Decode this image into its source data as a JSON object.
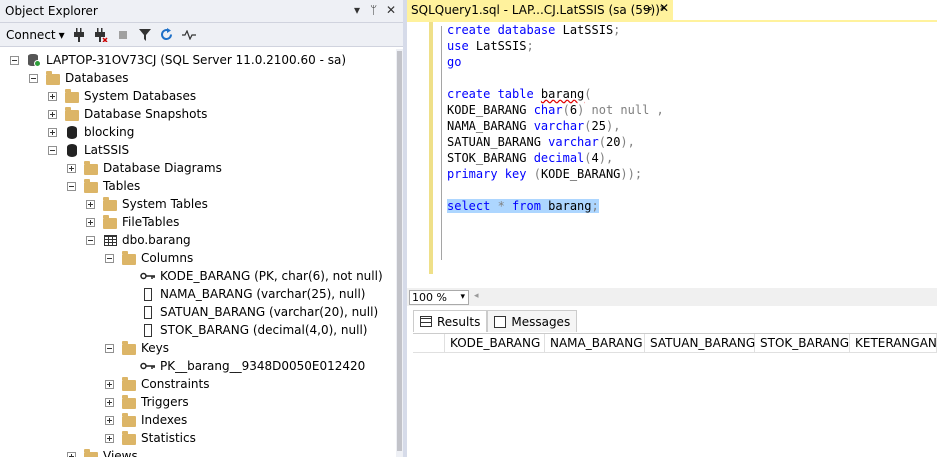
{
  "object_explorer": {
    "title": "Object Explorer",
    "controls": [
      "▾",
      "ᛘ",
      "✕"
    ],
    "toolbar": {
      "connect_label": "Connect",
      "connect_arrow": "▾"
    },
    "tree": [
      {
        "label": "LAPTOP-31OV73CJ (SQL Server 11.0.2100.60 - sa)",
        "icon": "server-icon",
        "expander": "minus",
        "level": 0
      },
      {
        "label": "Databases",
        "icon": "folder-icon",
        "expander": "minus",
        "level": 1
      },
      {
        "label": "System Databases",
        "icon": "folder-icon",
        "expander": "plus",
        "level": 2
      },
      {
        "label": "Database Snapshots",
        "icon": "folder-icon",
        "expander": "plus",
        "level": 2
      },
      {
        "label": "blocking",
        "icon": "database-icon",
        "expander": "plus",
        "level": 2
      },
      {
        "label": "LatSSIS",
        "icon": "database-icon",
        "expander": "minus",
        "level": 2
      },
      {
        "label": "Database Diagrams",
        "icon": "folder-icon",
        "expander": "plus",
        "level": 3
      },
      {
        "label": "Tables",
        "icon": "folder-icon",
        "expander": "minus",
        "level": 3
      },
      {
        "label": "System Tables",
        "icon": "folder-icon",
        "expander": "plus",
        "level": 4
      },
      {
        "label": "FileTables",
        "icon": "folder-icon",
        "expander": "plus",
        "level": 4
      },
      {
        "label": "dbo.barang",
        "icon": "table-icon",
        "expander": "minus",
        "level": 4
      },
      {
        "label": "Columns",
        "icon": "folder-icon",
        "expander": "minus",
        "level": 5
      },
      {
        "label": "KODE_BARANG (PK, char(6), not null)",
        "icon": "key-icon",
        "expander": "none",
        "level": 6
      },
      {
        "label": "NAMA_BARANG (varchar(25), null)",
        "icon": "column-icon",
        "expander": "none",
        "level": 6
      },
      {
        "label": "SATUAN_BARANG (varchar(20), null)",
        "icon": "column-icon",
        "expander": "none",
        "level": 6
      },
      {
        "label": "STOK_BARANG (decimal(4,0), null)",
        "icon": "column-icon",
        "expander": "none",
        "level": 6
      },
      {
        "label": "Keys",
        "icon": "folder-icon",
        "expander": "minus",
        "level": 5
      },
      {
        "label": "PK__barang__9348D0050E012420",
        "icon": "key-icon",
        "expander": "none",
        "level": 6
      },
      {
        "label": "Constraints",
        "icon": "folder-icon",
        "expander": "plus",
        "level": 5
      },
      {
        "label": "Triggers",
        "icon": "folder-icon",
        "expander": "plus",
        "level": 5
      },
      {
        "label": "Indexes",
        "icon": "folder-icon",
        "expander": "plus",
        "level": 5
      },
      {
        "label": "Statistics",
        "icon": "folder-icon",
        "expander": "plus",
        "level": 5
      },
      {
        "label": "Views",
        "icon": "folder-icon",
        "expander": "plus",
        "level": 3
      }
    ]
  },
  "query_tab": {
    "title": "SQLQuery1.sql - LAP...CJ.LatSSIS (sa (59))*",
    "pin": "⊸",
    "close": "✕"
  },
  "editor": {
    "lines": [
      [
        {
          "t": "create database ",
          "c": "kw"
        },
        {
          "t": "LatSSIS",
          "c": "id"
        },
        {
          "t": ";",
          "c": "op"
        }
      ],
      [
        {
          "t": "use ",
          "c": "kw"
        },
        {
          "t": "LatSSIS",
          "c": "id"
        },
        {
          "t": ";",
          "c": "op"
        }
      ],
      [
        {
          "t": "go",
          "c": "kw"
        }
      ],
      [],
      [
        {
          "t": "create table ",
          "c": "kw"
        },
        {
          "t": "barang",
          "c": "id sq"
        },
        {
          "t": "(",
          "c": "op"
        }
      ],
      [
        {
          "t": "KODE_BARANG ",
          "c": "id"
        },
        {
          "t": "char",
          "c": "ty"
        },
        {
          "t": "(",
          "c": "op"
        },
        {
          "t": "6",
          "c": "id"
        },
        {
          "t": ") not null ,",
          "c": "op"
        }
      ],
      [
        {
          "t": "NAMA_BARANG ",
          "c": "id"
        },
        {
          "t": "varchar",
          "c": "ty"
        },
        {
          "t": "(",
          "c": "op"
        },
        {
          "t": "25",
          "c": "id"
        },
        {
          "t": "),",
          "c": "op"
        }
      ],
      [
        {
          "t": "SATUAN_BARANG ",
          "c": "id"
        },
        {
          "t": "varchar",
          "c": "ty"
        },
        {
          "t": "(",
          "c": "op"
        },
        {
          "t": "20",
          "c": "id"
        },
        {
          "t": "),",
          "c": "op"
        }
      ],
      [
        {
          "t": "STOK_BARANG ",
          "c": "id"
        },
        {
          "t": "decimal",
          "c": "ty"
        },
        {
          "t": "(",
          "c": "op"
        },
        {
          "t": "4",
          "c": "id"
        },
        {
          "t": "),",
          "c": "op"
        }
      ],
      [
        {
          "t": "primary key ",
          "c": "kw"
        },
        {
          "t": "(",
          "c": "op"
        },
        {
          "t": "KODE_BARANG",
          "c": "id"
        },
        {
          "t": "));",
          "c": "op"
        }
      ],
      [],
      [
        {
          "t": "select ",
          "c": "kw sel"
        },
        {
          "t": "* ",
          "c": "op sel"
        },
        {
          "t": "from ",
          "c": "kw sel"
        },
        {
          "t": "barang",
          "c": "id sel"
        },
        {
          "t": ";",
          "c": "op sel"
        }
      ]
    ]
  },
  "zoom": {
    "value": "100 %",
    "arrow": "▾",
    "scroll_left": "◂"
  },
  "results": {
    "tabs": [
      {
        "label": "Results",
        "icon": "grid-icon",
        "active": true
      },
      {
        "label": "Messages",
        "icon": "messages-icon",
        "active": false
      }
    ],
    "columns": [
      "KODE_BARANG",
      "NAMA_BARANG",
      "SATUAN_BARANG",
      "STOK_BARANG",
      "KETERANGAN"
    ]
  }
}
